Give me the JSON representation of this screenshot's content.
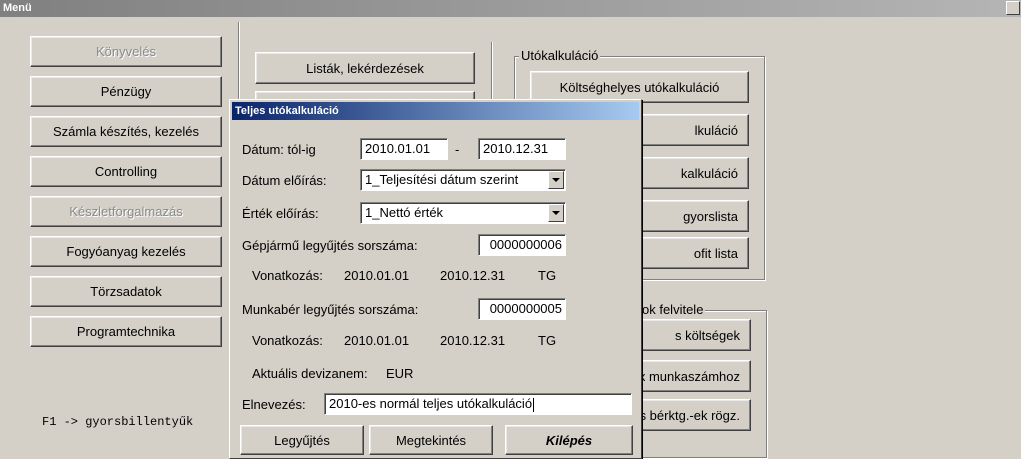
{
  "window": {
    "title": "Menü"
  },
  "left_menu": [
    {
      "label": "Könyvelés",
      "disabled": true
    },
    {
      "label": "Pénzügy",
      "disabled": false
    },
    {
      "label": "Számla készítés, kezelés",
      "disabled": false
    },
    {
      "label": "Controlling",
      "disabled": false
    },
    {
      "label": "Készletforgalmazás",
      "disabled": true
    },
    {
      "label": "Fogyóanyag kezelés",
      "disabled": false
    },
    {
      "label": "Törzsadatok",
      "disabled": false
    },
    {
      "label": "Programtechnika",
      "disabled": false
    }
  ],
  "hint": "F1 -> gyorsbillentyűk",
  "middle": {
    "lists_button": "Listák, lekérdezések"
  },
  "utokalkulacio_group": {
    "label": "Utókalkuláció",
    "buttons": [
      "Költséghelyes utókalkuláció",
      "lkuláció",
      "kalkuláció",
      "gyorslista",
      "ofit lista"
    ]
  },
  "second_group": {
    "label": "ok felvitele",
    "buttons": [
      "s költségek",
      "ix munkaszámhoz",
      "os bérktg.-ek rögz."
    ]
  },
  "dialog": {
    "title": "Teljes utókalkuláció",
    "date_label": "Dátum: tól-ig",
    "date_from": "2010.01.01",
    "date_separator": "-",
    "date_to": "2010.12.31",
    "date_rule_label": "Dátum előírás:",
    "date_rule_value": "1_Teljesítési dátum szerint",
    "value_rule_label": "Érték előírás:",
    "value_rule_value": "1_Nettó érték",
    "vehicle_label": "Gépjármű legyűjtés sorszáma:",
    "vehicle_value": "0000000006",
    "vehicle_ref": {
      "label": "Vonatkozás:",
      "from": "2010.01.01",
      "to": "2010.12.31",
      "code": "TG"
    },
    "wage_label": "Munkabér legyűjtés sorszáma:",
    "wage_value": "0000000005",
    "wage_ref": {
      "label": "Vonatkozás:",
      "from": "2010.01.01",
      "to": "2010.12.31",
      "code": "TG"
    },
    "currency_label": "Aktuális devizanem:",
    "currency_value": "EUR",
    "name_label": "Elnevezés:",
    "name_value": "2010-es normál teljes utókalkuláció",
    "buttons": {
      "collect": "Legyűjtés",
      "view": "Megtekintés",
      "exit": "Kilépés"
    }
  }
}
